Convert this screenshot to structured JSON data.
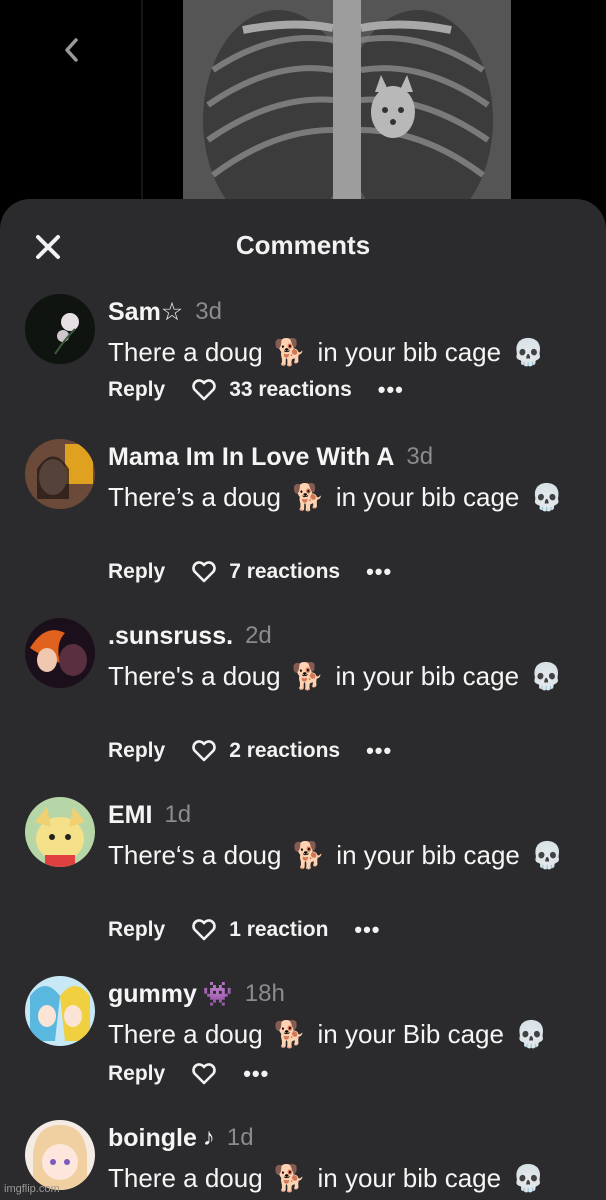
{
  "header": {
    "title": "Comments"
  },
  "labels": {
    "reply": "Reply",
    "more": "•••"
  },
  "comments": [
    {
      "name": "Sam☆",
      "time": "3d",
      "text_a": "There a doug",
      "text_b": "in your bib cage",
      "reactions": "33 reactions"
    },
    {
      "name": "Mama Im In Love With A",
      "time": "3d",
      "text_a": "There’s a doug",
      "text_b": "in your bib cage",
      "reactions": "7 reactions"
    },
    {
      "name": ".sunsruss.",
      "time": "2d",
      "text_a": "There's a doug",
      "text_b": "in your bib cage",
      "reactions": "2 reactions"
    },
    {
      "name": "EMI",
      "time": "1d",
      "text_a": "There‘s a doug",
      "text_b": "in your bib cage",
      "reactions": "1 reaction"
    },
    {
      "name": "gummy",
      "time": "18h",
      "text_a": "There a doug",
      "text_b": "in your Bib cage",
      "reactions": ""
    },
    {
      "name": "boingle",
      "time": "1d",
      "text_a": "There a doug",
      "text_b": "in your bib cage",
      "reactions": ""
    }
  ],
  "emoji": {
    "dog": "🐕",
    "skull": "💀",
    "invader": "👾",
    "note": "♪"
  },
  "watermark": "imgflip.com",
  "colors": {
    "sheet": "#2b2b2d",
    "time": "#8b8b8d"
  }
}
